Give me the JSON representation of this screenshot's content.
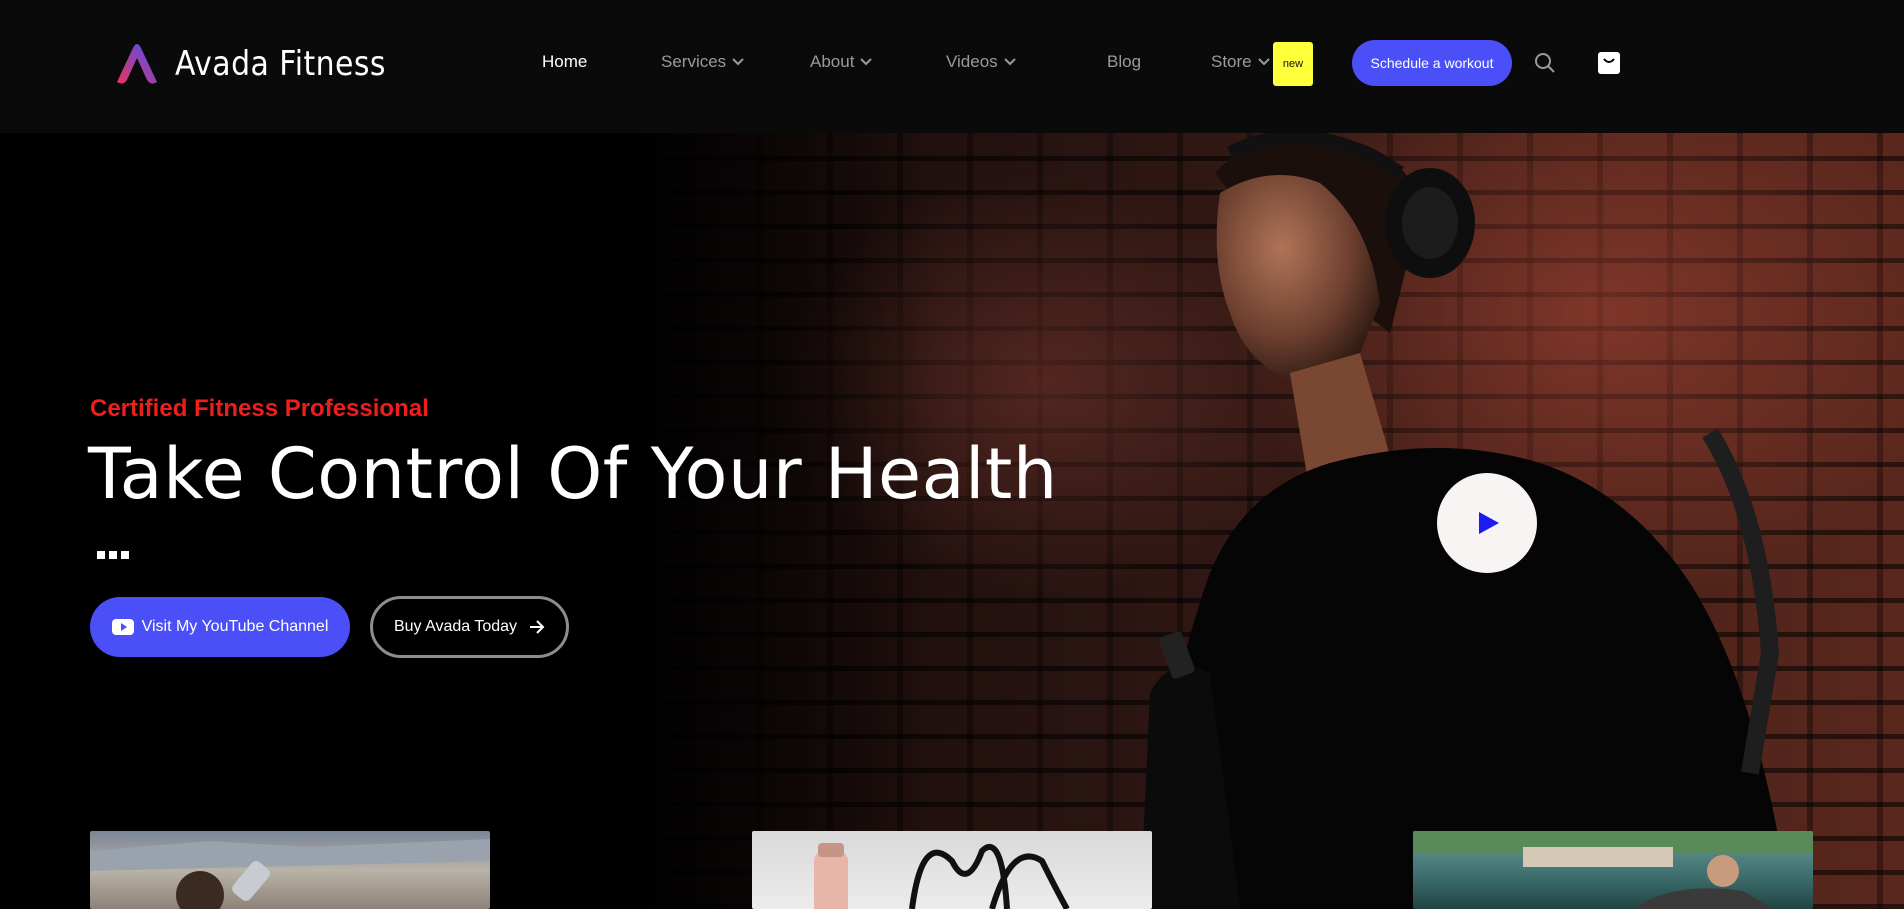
{
  "brand": {
    "name": "Avada Fitness",
    "logo_icon": "avada-a-logo"
  },
  "nav": {
    "items": [
      {
        "label": "Home",
        "active": true,
        "dropdown": false
      },
      {
        "label": "Services",
        "active": false,
        "dropdown": true
      },
      {
        "label": "About",
        "active": false,
        "dropdown": true
      },
      {
        "label": "Videos",
        "active": false,
        "dropdown": true
      },
      {
        "label": "Blog",
        "active": false,
        "dropdown": false
      },
      {
        "label": "Store",
        "active": false,
        "dropdown": true
      }
    ],
    "badge": "new",
    "cta": "Schedule a workout",
    "search_icon": "search-icon",
    "cart_icon": "shopping-bag-icon"
  },
  "hero": {
    "eyebrow": "Certified Fitness Professional",
    "headline": "Take Control Of Your Health",
    "primary_button": "Visit My YouTube Channel",
    "primary_button_icon": "youtube-icon",
    "secondary_button": "Buy Avada Today",
    "secondary_button_icon": "arrow-right-icon",
    "play_icon": "play-icon"
  },
  "colors": {
    "accent": "#4b4ff7",
    "eyebrow": "#f01d1d",
    "badge": "#ffff3a",
    "header_bg": "#0a0a0a"
  }
}
